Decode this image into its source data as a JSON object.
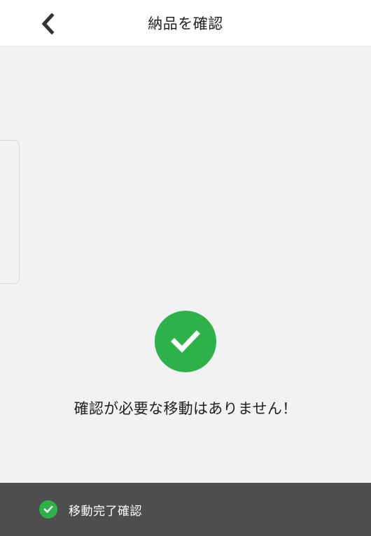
{
  "header": {
    "title": "納品を確認",
    "back_icon": "chevron-left-icon"
  },
  "main": {
    "status_icon": "check-circle-icon",
    "message": "確認が必要な移動はありません！"
  },
  "bottom_bar": {
    "icon": "check-circle-icon",
    "label": "移動完了確認"
  },
  "colors": {
    "accent_green": "#2db24a",
    "bottom_bar_bg": "#4e4e4e",
    "header_bg": "#ffffff",
    "page_bg": "#f2f2f2"
  }
}
